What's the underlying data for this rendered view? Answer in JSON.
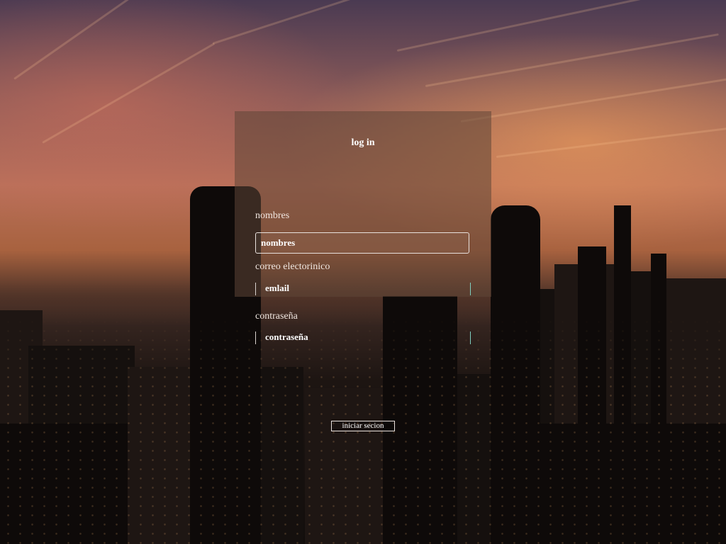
{
  "form": {
    "title": "log in",
    "name_label": "nombres",
    "name_value": "nombres",
    "email_label": "correo electorinico",
    "email_value": "emlail",
    "password_label": "contraseña",
    "password_value": "contraseña",
    "submit_label": "iniciar secion"
  },
  "colors": {
    "card_overlay": "#5f4637",
    "text": "#ffffff",
    "field_border": "#e8e1dd"
  }
}
